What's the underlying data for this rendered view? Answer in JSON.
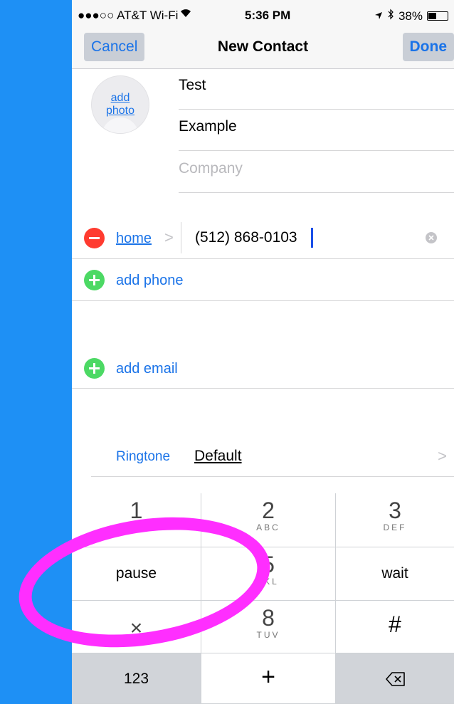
{
  "status_bar": {
    "carrier": "●●●○○ AT&T Wi-Fi",
    "wifi_icon": "wifi-icon",
    "time": "5:36 PM",
    "location_icon": "location-arrow-icon",
    "bluetooth_icon": "bluetooth-icon",
    "battery": "38%",
    "battery_level": 0.38
  },
  "nav": {
    "cancel": "Cancel",
    "title": "New Contact",
    "done": "Done"
  },
  "photo": {
    "label": "add photo"
  },
  "fields": {
    "first_name": "Test",
    "last_name": "Example",
    "company_placeholder": "Company"
  },
  "phone": {
    "label": "home",
    "chevron": ">",
    "value": "(512) 868-0103"
  },
  "add_phone": "add phone",
  "add_email": "add email",
  "ringtone": {
    "label": "Ringtone",
    "value": "Default",
    "chevron": ">"
  },
  "keypad": {
    "k1": "1",
    "k2": {
      "num": "2",
      "letters": "ABC"
    },
    "k3": {
      "num": "3",
      "letters": "DEF"
    },
    "pause": "pause",
    "k5": {
      "num": "5",
      "letters": "JKL"
    },
    "wait": "wait",
    "k_star": "×",
    "k8": {
      "num": "8",
      "letters": "TUV"
    },
    "k_hash": "#",
    "k123": "123",
    "k_plus": "+",
    "delete_icon": "delete-backspace-icon"
  },
  "annotation": {
    "color": "#ff2eff"
  }
}
